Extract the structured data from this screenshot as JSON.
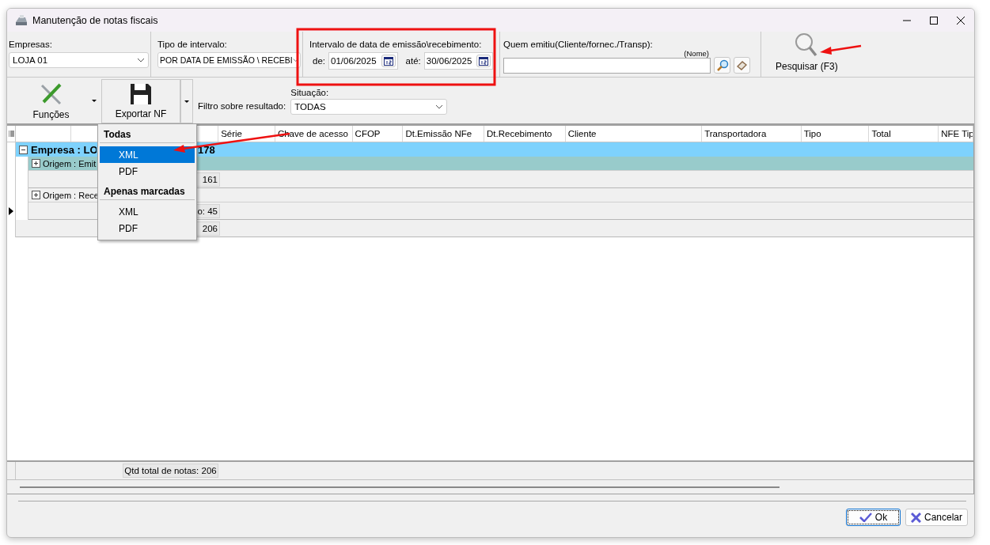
{
  "window": {
    "title": "Manutenção de notas fiscais"
  },
  "filters": {
    "empresas": {
      "label": "Empresas:",
      "value": "LOJA 01"
    },
    "tipo_intervalo": {
      "label": "Tipo de intervalo:",
      "value": "POR DATA DE EMISSÃO \\ RECEBI"
    },
    "intervalo": {
      "label": "Intervalo de data de emissão\\recebimento:",
      "de_label": "de:",
      "de_value": "01/06/2025",
      "ate_label": "até:",
      "ate_value": "30/06/2025"
    },
    "quem_emitiu": {
      "label": "Quem emitiu(Cliente/fornec./Transp):",
      "hint": "(Nome)"
    },
    "search_button": "Pesquisar (F3)"
  },
  "toolbar": {
    "funcoes": "Funções",
    "exportar": "Exportar NF",
    "filtro_label": "Filtro sobre resultado:",
    "situacao": {
      "label": "Situação:",
      "value": "TODAS"
    }
  },
  "export_menu": [
    {
      "title": "Todas",
      "items": [
        {
          "label": "XML",
          "selected": true
        },
        {
          "label": "PDF",
          "selected": false
        }
      ]
    },
    {
      "title": "Apenas marcadas",
      "items": [
        {
          "label": "XML",
          "selected": false
        },
        {
          "label": "PDF",
          "selected": false
        }
      ]
    }
  ],
  "table": {
    "columns": [
      "Série",
      "Chave de acesso",
      "CFOP",
      "Dt.Emissão NFe",
      "Dt.Recebimento",
      "Cliente",
      "Transportadora",
      "Tipo",
      "Total",
      "NFE Tip"
    ],
    "groups": [
      {
        "label": "Empresa : LO",
        "count": "178",
        "expanded": true,
        "summary": "206",
        "children": [
          {
            "label": "Origem : Emit",
            "expanded": false,
            "selected": true,
            "summary": "161",
            "current": false
          },
          {
            "label": "Origem : Rece",
            "expanded": false,
            "selected": false,
            "summary": "o: 45",
            "current": true
          }
        ]
      }
    ],
    "footer": "Qtd total de notas: 206"
  },
  "buttons": [
    {
      "label": "Ok",
      "kind": "ok"
    },
    {
      "label": "Cancelar",
      "kind": "cancel"
    }
  ]
}
